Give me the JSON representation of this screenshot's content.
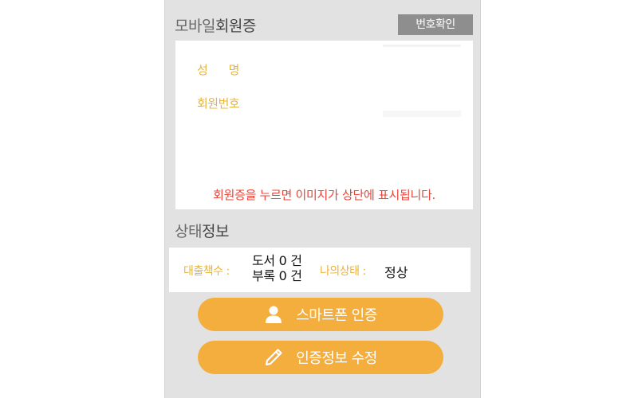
{
  "card_section": {
    "title_light": "모바일",
    "title_strong": "회원증",
    "number_check_button": "번호확인",
    "name_label": "성 명",
    "member_no_label": "회원번호",
    "notice": "회원증을 누르면 이미지가 상단에 표시됩니다."
  },
  "status_section": {
    "title_light": "상태",
    "title_strong": "정보",
    "loan_count_label": "대출책수 :",
    "books_line": "도서 0 건",
    "appendix_line": "부록 0 건",
    "my_status_label": "나의상태 :",
    "my_status_value": "정상"
  },
  "buttons": {
    "smartphone_auth": "스마트폰 인증",
    "edit_auth_info": "인증정보 수정"
  },
  "icons": {
    "smartphone_auth": "user-icon",
    "edit_auth_info": "pencil-icon"
  },
  "colors": {
    "accent_orange": "#f4ae3d",
    "label_yellow": "#e8b43a",
    "notice_red": "#e8443a",
    "button_gray": "#8e8e8e",
    "panel_bg": "#e2e2e2"
  }
}
